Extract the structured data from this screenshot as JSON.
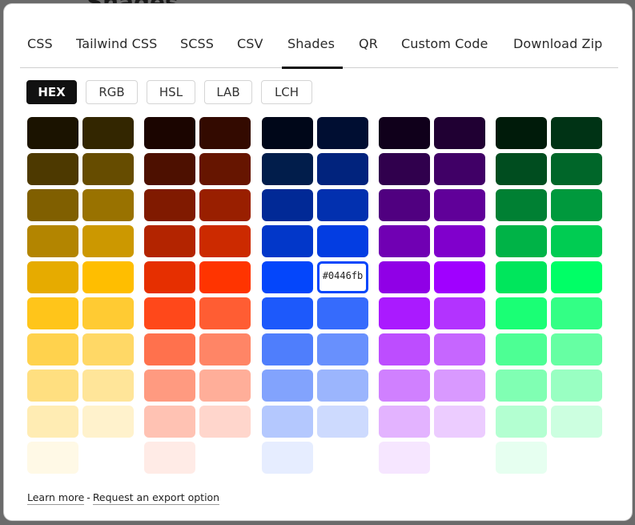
{
  "backdrop": {
    "title": "Shades"
  },
  "tabs": [
    {
      "label": "CSS",
      "active": false
    },
    {
      "label": "Tailwind CSS",
      "active": false
    },
    {
      "label": "SCSS",
      "active": false
    },
    {
      "label": "CSV",
      "active": false
    },
    {
      "label": "Shades",
      "active": true
    },
    {
      "label": "QR",
      "active": false
    },
    {
      "label": "Custom Code",
      "active": false
    },
    {
      "label": "Download Zip",
      "active": false
    }
  ],
  "formats": [
    {
      "label": "HEX",
      "active": true
    },
    {
      "label": "RGB",
      "active": false
    },
    {
      "label": "HSL",
      "active": false
    },
    {
      "label": "LAB",
      "active": false
    },
    {
      "label": "LCH",
      "active": false
    }
  ],
  "palettes": [
    {
      "name": "yellow",
      "colors": [
        "#1b1300",
        "#332600",
        "#4d3900",
        "#664c00",
        "#805f00",
        "#997200",
        "#b38500",
        "#cc9800",
        "#e6ab00",
        "#ffbe00",
        "#ffc51a",
        "#ffcb33",
        "#ffd24d",
        "#ffd866",
        "#ffdf80",
        "#ffe599",
        "#ffecb3",
        "#fff2cc",
        "#fff9e6",
        "#ffffff"
      ]
    },
    {
      "name": "red",
      "colors": [
        "#1b0500",
        "#330a00",
        "#4d1000",
        "#661500",
        "#801a00",
        "#991f00",
        "#b32400",
        "#cc2a00",
        "#e62f00",
        "#ff3400",
        "#ff481a",
        "#ff5d33",
        "#ff714d",
        "#ff8566",
        "#ff9a80",
        "#ffae99",
        "#ffc2b3",
        "#ffd6cc",
        "#ffebe6",
        "#ffffff"
      ]
    },
    {
      "name": "blue",
      "colors": [
        "#000719",
        "#000e32",
        "#011d4b",
        "#01237d",
        "#012996",
        "#0230af",
        "#0237c9",
        "#033de2",
        "#0446fb",
        "#0446fb",
        "#1d59fb",
        "#366bfc",
        "#4f7efc",
        "#6890fd",
        "#82a3fd",
        "#9bb5fd",
        "#b4c8fe",
        "#cddafe",
        "#e6edff",
        "#ffffff"
      ]
    },
    {
      "name": "purple",
      "colors": [
        "#10001b",
        "#200033",
        "#30004d",
        "#400066",
        "#500080",
        "#600099",
        "#7000b3",
        "#8000cc",
        "#9000e6",
        "#a000ff",
        "#aa1aff",
        "#b333ff",
        "#bd4dff",
        "#c666ff",
        "#d080ff",
        "#d999ff",
        "#e3b3ff",
        "#ecccff",
        "#f6e6ff",
        "#ffffff"
      ]
    },
    {
      "name": "green",
      "colors": [
        "#001b0a",
        "#003315",
        "#004d1f",
        "#006629",
        "#008033",
        "#00993d",
        "#00b347",
        "#00cc52",
        "#00e65c",
        "#00ff66",
        "#1aff75",
        "#33ff85",
        "#4dff94",
        "#66ffa3",
        "#80ffb3",
        "#99ffc2",
        "#b3ffd1",
        "#ccffe0",
        "#e6fff0",
        "#ffffff"
      ]
    }
  ],
  "hover": {
    "palette": 2,
    "index": 9,
    "label": "#0446fb"
  },
  "footer": {
    "learn_more": "Learn more",
    "separator": "-",
    "request": "Request an export option"
  }
}
